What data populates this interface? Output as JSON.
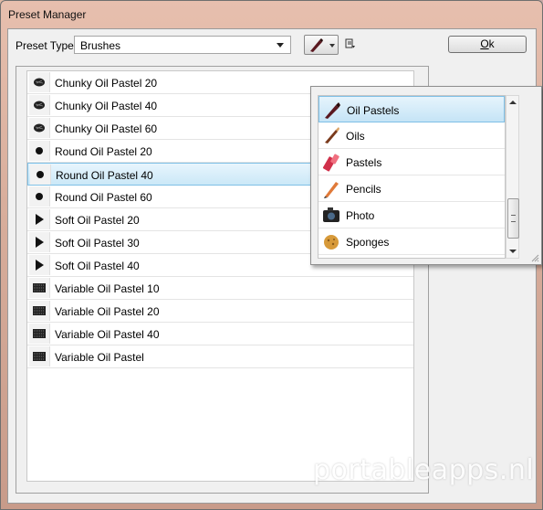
{
  "window": {
    "title": "Preset Manager"
  },
  "toolbar": {
    "preset_type_label": "Preset Type:",
    "preset_type_value": "Brushes",
    "ok_prefix": "O",
    "ok_suffix": "k"
  },
  "brush_list": [
    {
      "name": "Chunky Oil Pastel 20",
      "icon": "chunky-brush-icon",
      "selected": false
    },
    {
      "name": "Chunky Oil Pastel 40",
      "icon": "chunky-brush-icon",
      "selected": false
    },
    {
      "name": "Chunky Oil Pastel 60",
      "icon": "chunky-brush-icon",
      "selected": false
    },
    {
      "name": "Round Oil Pastel 20",
      "icon": "round-brush-icon",
      "selected": false
    },
    {
      "name": "Round Oil Pastel 40",
      "icon": "round-brush-icon",
      "selected": true
    },
    {
      "name": "Round Oil Pastel 60",
      "icon": "round-brush-icon",
      "selected": false
    },
    {
      "name": "Soft Oil Pastel 20",
      "icon": "soft-brush-icon",
      "selected": false
    },
    {
      "name": "Soft Oil Pastel 30",
      "icon": "soft-brush-icon",
      "selected": false
    },
    {
      "name": "Soft Oil Pastel 40",
      "icon": "soft-brush-icon",
      "selected": false
    },
    {
      "name": "Variable Oil Pastel 10",
      "icon": "variable-brush-icon",
      "selected": false
    },
    {
      "name": "Variable Oil Pastel 20",
      "icon": "variable-brush-icon",
      "selected": false
    },
    {
      "name": "Variable Oil Pastel 40",
      "icon": "variable-brush-icon",
      "selected": false
    },
    {
      "name": "Variable Oil Pastel",
      "icon": "variable-brush-icon",
      "selected": false
    }
  ],
  "popup": {
    "items": [
      {
        "label": "Oil Pastels",
        "icon": "oil-pastel-icon",
        "selected": true
      },
      {
        "label": "Oils",
        "icon": "oil-brush-icon",
        "selected": false
      },
      {
        "label": "Pastels",
        "icon": "pastel-icon",
        "selected": false
      },
      {
        "label": "Pencils",
        "icon": "pencil-icon",
        "selected": false
      },
      {
        "label": "Photo",
        "icon": "camera-icon",
        "selected": false
      },
      {
        "label": "Sponges",
        "icon": "sponge-icon",
        "selected": false
      }
    ]
  },
  "watermark": "portableapps.nl",
  "colors": {
    "selection": "#cbe8f7",
    "selection_border": "#7fc0e6",
    "dialog_bg": "#f0f0f0"
  }
}
